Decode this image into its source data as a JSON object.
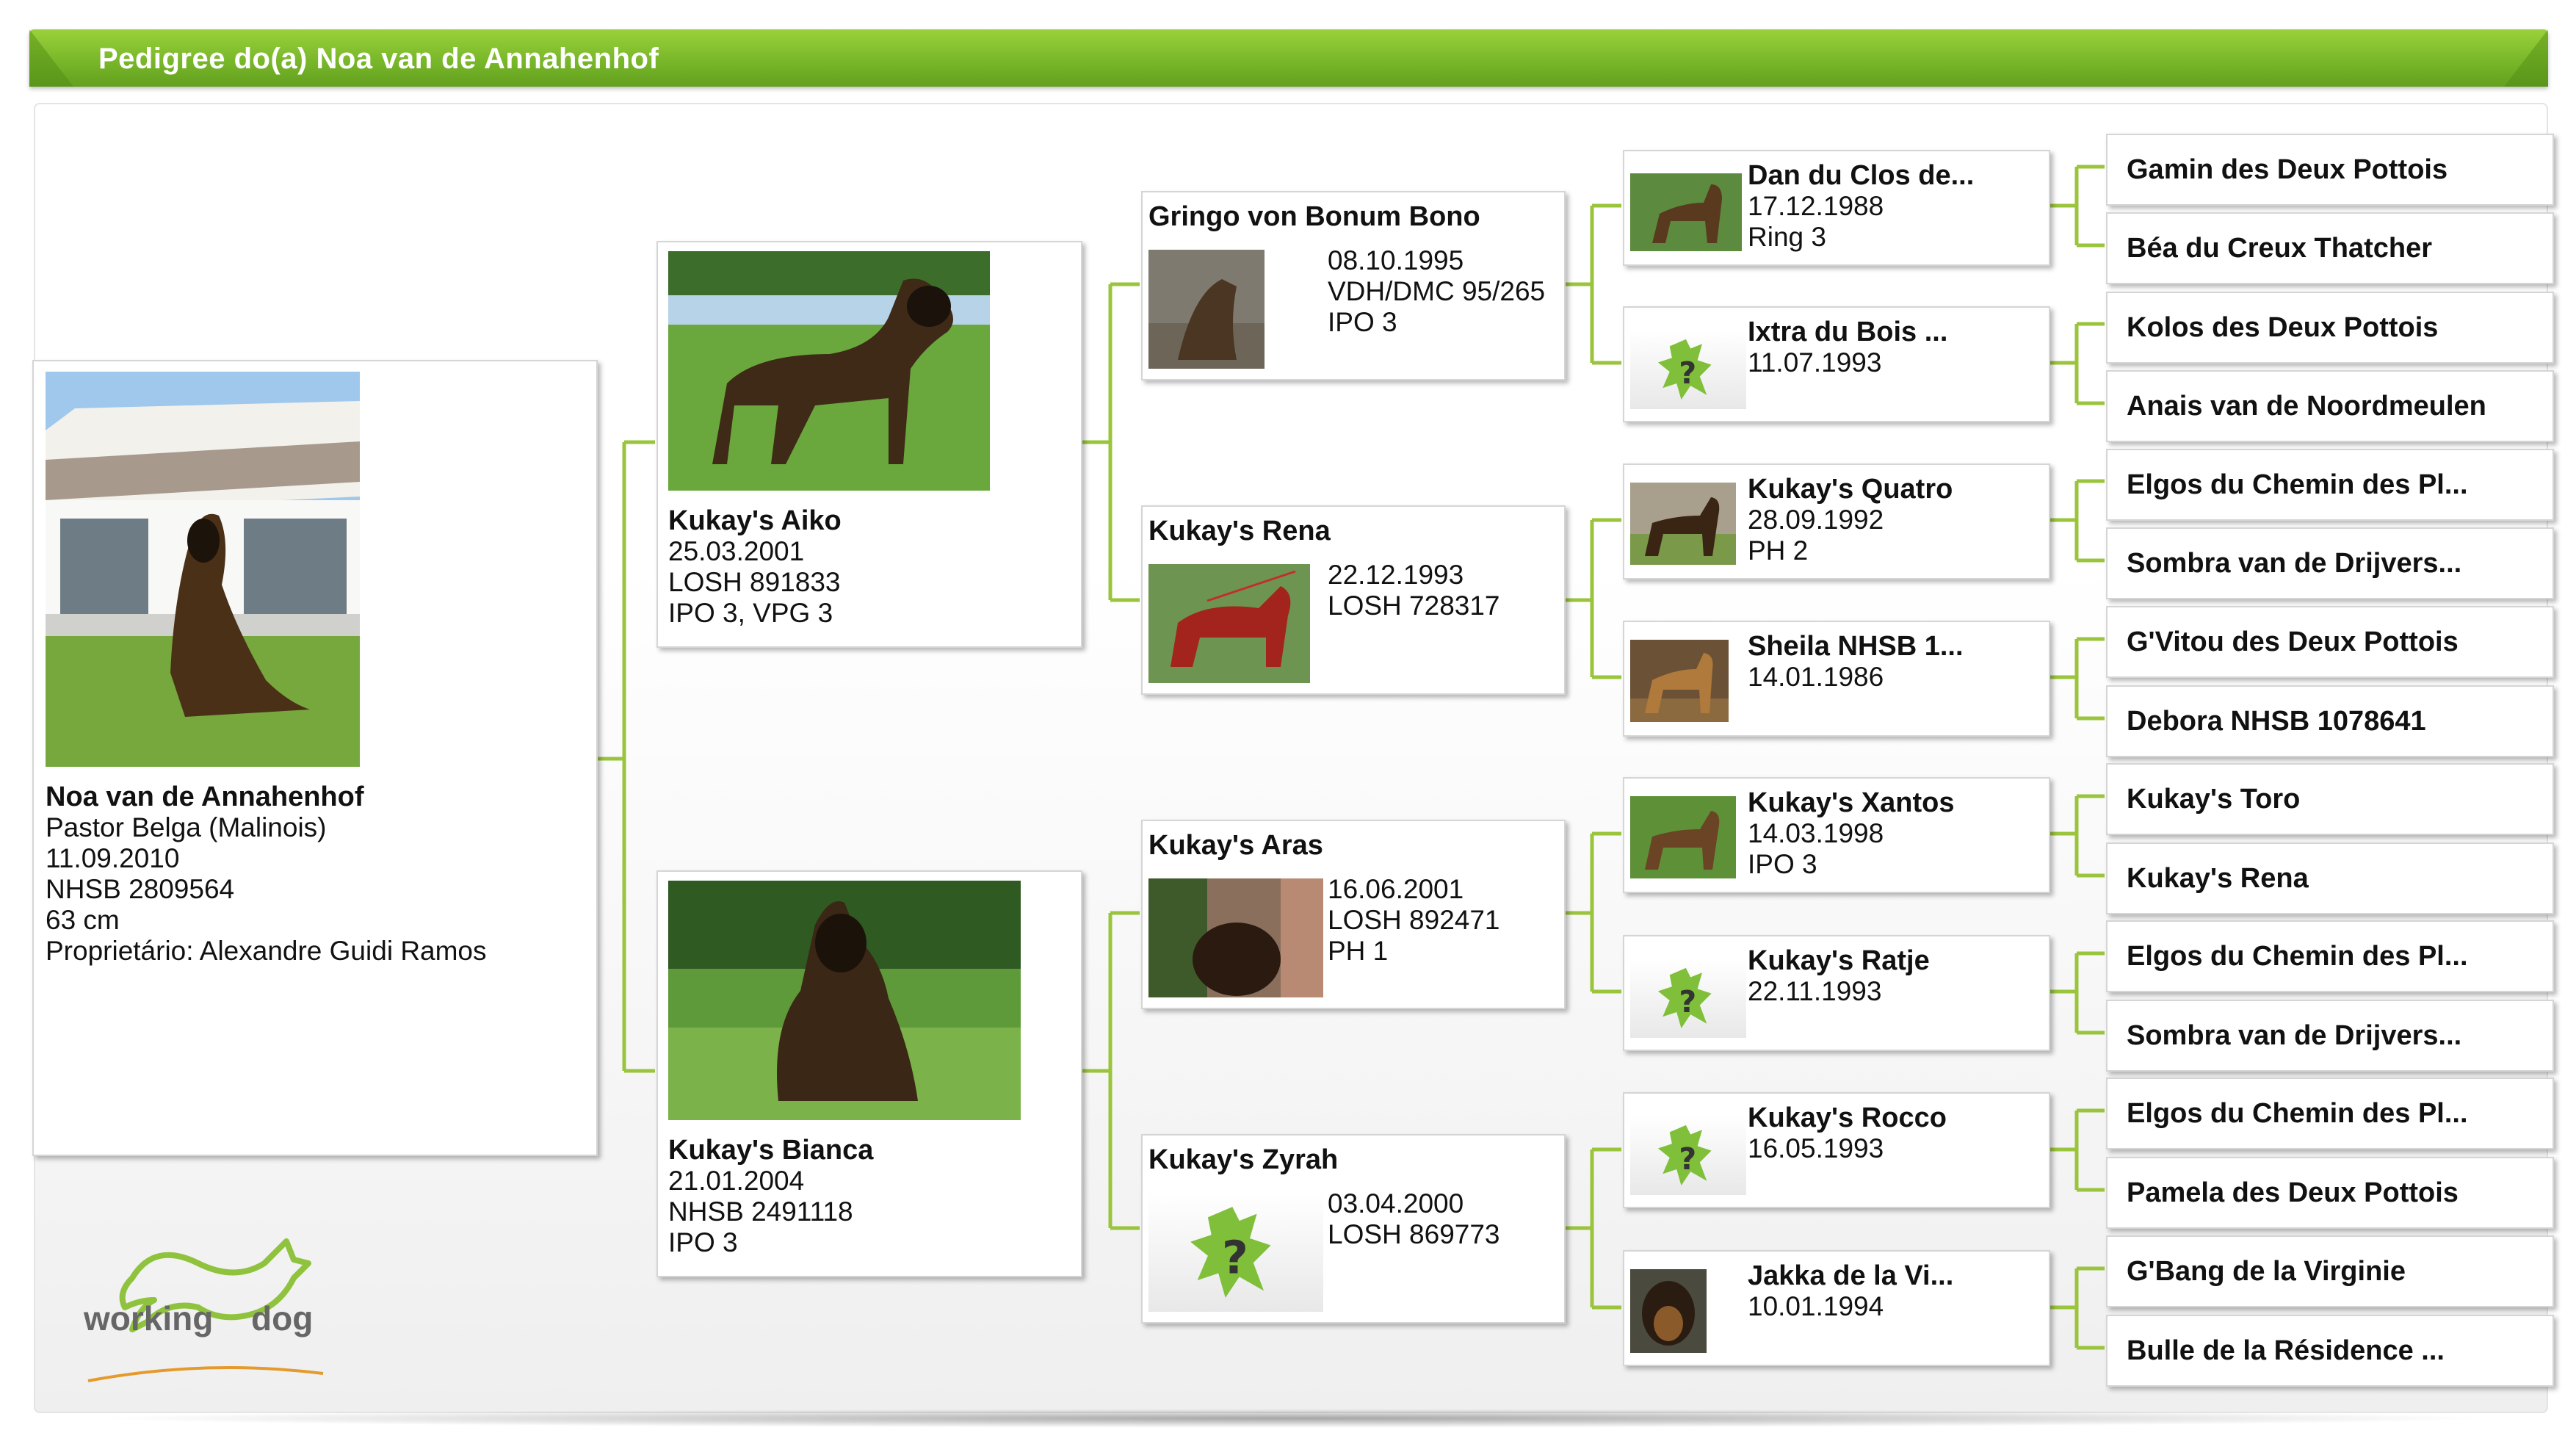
{
  "header": {
    "title": "Pedigree do(a) Noa van de Annahenhof"
  },
  "subject": {
    "name": "Noa van de Annahenhof",
    "lines": [
      "Pastor Belga (Malinois)",
      "11.09.2010",
      "NHSB 2809564",
      "63 cm",
      "Proprietário: Alexandre Guidi Ramos"
    ]
  },
  "parents": [
    {
      "name": "Kukay's Aiko",
      "lines": [
        "25.03.2001",
        "LOSH 891833",
        "IPO 3, VPG 3"
      ]
    },
    {
      "name": "Kukay's Bianca",
      "lines": [
        "21.01.2004",
        "NHSB 2491118",
        "IPO 3"
      ]
    }
  ],
  "grandparents": [
    {
      "name": "Gringo von Bonum Bono",
      "lines": [
        "08.10.1995",
        "VDH/DMC 95/265",
        "IPO 3"
      ]
    },
    {
      "name": "Kukay's Rena",
      "lines": [
        "22.12.1993",
        "LOSH 728317"
      ]
    },
    {
      "name": "Kukay's Aras",
      "lines": [
        "16.06.2001",
        "LOSH 892471",
        "PH 1"
      ]
    },
    {
      "name": "Kukay's Zyrah",
      "lines": [
        "03.04.2000",
        "LOSH 869773"
      ]
    }
  ],
  "great_grandparents": [
    {
      "name": "Dan du Clos de...",
      "lines": [
        "17.12.1988",
        "Ring 3"
      ]
    },
    {
      "name": "Ixtra du Bois ...",
      "lines": [
        "11.07.1993"
      ]
    },
    {
      "name": "Kukay's Quatro",
      "lines": [
        "28.09.1992",
        "PH 2"
      ]
    },
    {
      "name": "Sheila  NHSB 1...",
      "lines": [
        "14.01.1986"
      ]
    },
    {
      "name": "Kukay's Xantos",
      "lines": [
        "14.03.1998",
        "IPO 3"
      ]
    },
    {
      "name": "Kukay's Ratje",
      "lines": [
        "22.11.1993"
      ]
    },
    {
      "name": "Kukay's Rocco",
      "lines": [
        "16.05.1993"
      ]
    },
    {
      "name": "Jakka de la Vi...",
      "lines": [
        "10.01.1994"
      ]
    }
  ],
  "ancestors_gen4": [
    "Gamin des Deux Pottois",
    "Béa du Creux Thatcher",
    "Kolos des Deux Pottois",
    "Anais van de Noordmeulen",
    "Elgos du Chemin des Pl...",
    "Sombra van de Drijvers...",
    "G'Vitou des Deux Pottois",
    "Debora NHSB 1078641",
    "Kukay's Toro",
    "Kukay's Rena",
    "Elgos du Chemin des Pl...",
    "Sombra van de Drijvers...",
    "Elgos du Chemin des Pl...",
    "Pamela des Deux Pottois",
    "G'Bang de la Virginie",
    "Bulle de la Résidence ..."
  ],
  "logo": {
    "text_left": "working",
    "text_right": "dog"
  },
  "colors": {
    "accent": "#7ab52c",
    "connector": "#9ac43c",
    "header_text": "#ffffff"
  }
}
